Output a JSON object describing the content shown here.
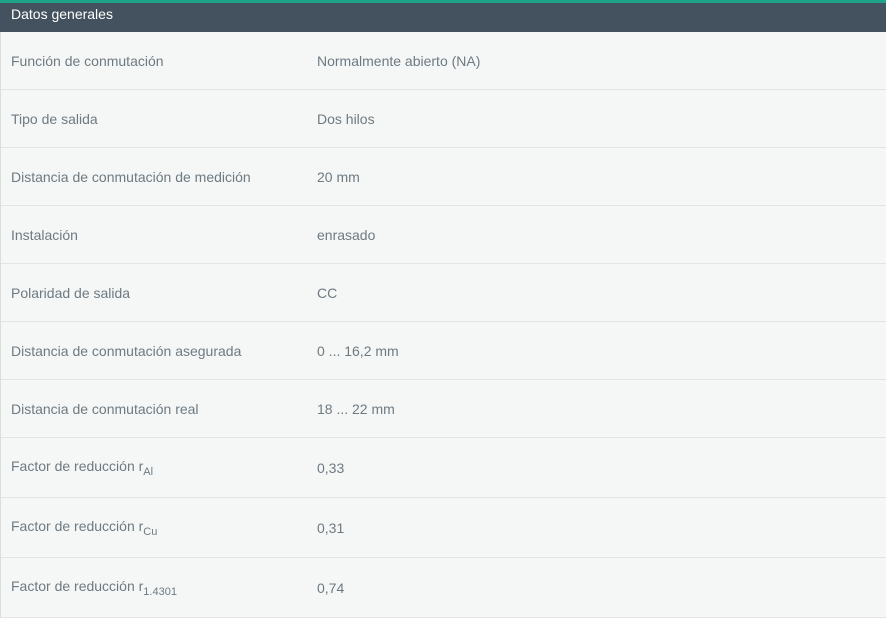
{
  "section": {
    "title": "Datos generales"
  },
  "rows": [
    {
      "label": "Función de conmutación",
      "value": "Normalmente abierto (NA)"
    },
    {
      "label": "Tipo de salida",
      "value": "Dos hilos"
    },
    {
      "label": "Distancia de conmutación de medición",
      "value": "20 mm"
    },
    {
      "label": "Instalación",
      "value": "enrasado"
    },
    {
      "label": "Polaridad de salida",
      "value": "CC"
    },
    {
      "label": "Distancia de conmutación asegurada",
      "value": "0 ... 16,2 mm"
    },
    {
      "label": "Distancia de conmutación real",
      "value": "18 ... 22 mm"
    },
    {
      "label": "Factor de reducción r",
      "sub": "Al",
      "value": "0,33"
    },
    {
      "label": "Factor de reducción r",
      "sub": "Cu",
      "value": "0,31"
    },
    {
      "label": "Factor de reducción r",
      "sub": "1.4301",
      "value": "0,74"
    }
  ],
  "colors": {
    "accent": "#1fa28a",
    "header_bg": "#43525e",
    "text": "#6e7a82",
    "background": "#f5f7f6"
  }
}
